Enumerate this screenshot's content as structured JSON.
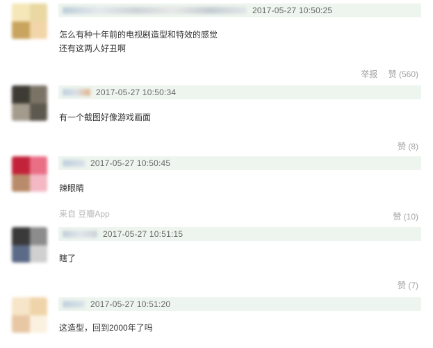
{
  "comments": [
    {
      "time": "2017-05-27 10:50:25",
      "content": "怎么有种十年前的电视剧造型和特效的感觉\n还有这两人好丑啊",
      "report_label": "举报",
      "like_label": "赞 (560)",
      "avatar_colors": [
        "#f5e7b8",
        "#e9d8a2",
        "#c9a45e",
        "#f2d5a8"
      ]
    },
    {
      "time": "2017-05-27 10:50:34",
      "content": "有一个截图好像游戏画面",
      "like_label": "赞 (8)",
      "avatar_colors": [
        "#3d3b34",
        "#7b7466",
        "#a49b8c",
        "#5e594f"
      ]
    },
    {
      "time": "2017-05-27 10:50:45",
      "content": "辣眼睛",
      "source_label": "来自 豆瓣App",
      "like_label": "赞 (10)",
      "avatar_colors": [
        "#c2233a",
        "#e96f86",
        "#b88b6a",
        "#f3b8c3"
      ]
    },
    {
      "time": "2017-05-27 10:51:15",
      "content": "瞎了",
      "like_label": "赞 (7)",
      "avatar_colors": [
        "#3a3a3a",
        "#8c8c8c",
        "#5b6a86",
        "#d0d0d0"
      ]
    },
    {
      "time": "2017-05-27 10:51:20",
      "content": "这造型，回到2000年了吗",
      "avatar_colors": [
        "#f6e5c8",
        "#f0d4a9",
        "#e8c7a5",
        "#fbf1e0"
      ]
    }
  ]
}
